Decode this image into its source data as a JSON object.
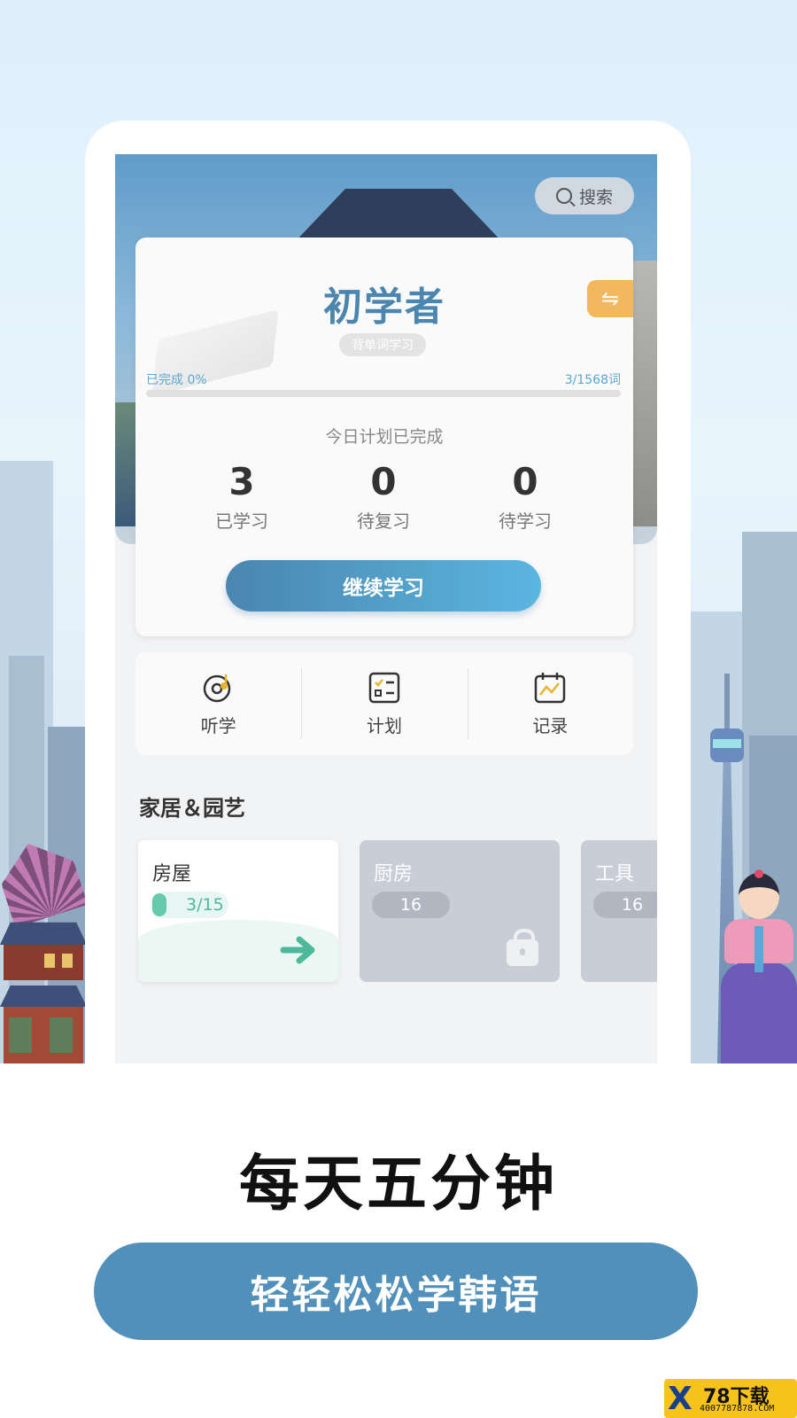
{
  "search": {
    "label": "搜索"
  },
  "level": {
    "title": "初学者",
    "book": "背单词学习",
    "switch_icon": "⇋"
  },
  "progress": {
    "completed_label": "已完成 0%",
    "fraction": 0.0,
    "words_label": "3/1568词"
  },
  "today": {
    "status": "今日计划已完成",
    "stats": [
      {
        "value": "3",
        "label": "已学习"
      },
      {
        "value": "0",
        "label": "待复习"
      },
      {
        "value": "0",
        "label": "待学习"
      }
    ],
    "continue_label": "继续学习"
  },
  "tools": [
    {
      "label": "听学",
      "icon": "listen-icon"
    },
    {
      "label": "计划",
      "icon": "plan-icon"
    },
    {
      "label": "记录",
      "icon": "record-icon"
    }
  ],
  "section": {
    "title": "家居＆园艺",
    "cards": [
      {
        "name": "房屋",
        "count": "3/15",
        "state": "active"
      },
      {
        "name": "厨房",
        "count": "16",
        "state": "locked"
      },
      {
        "name": "工具",
        "count": "16",
        "state": "locked"
      }
    ]
  },
  "promo": {
    "slogan": "每天五分钟",
    "cta": "轻轻松松学韩语"
  },
  "watermark": {
    "brand": "78下载",
    "site": "4007787878.COM",
    "logo": "X"
  },
  "colors": {
    "accent": "#4a86b0",
    "button": "#5190ba",
    "switch": "#f3b75e",
    "count_green": "#4fb89a"
  }
}
